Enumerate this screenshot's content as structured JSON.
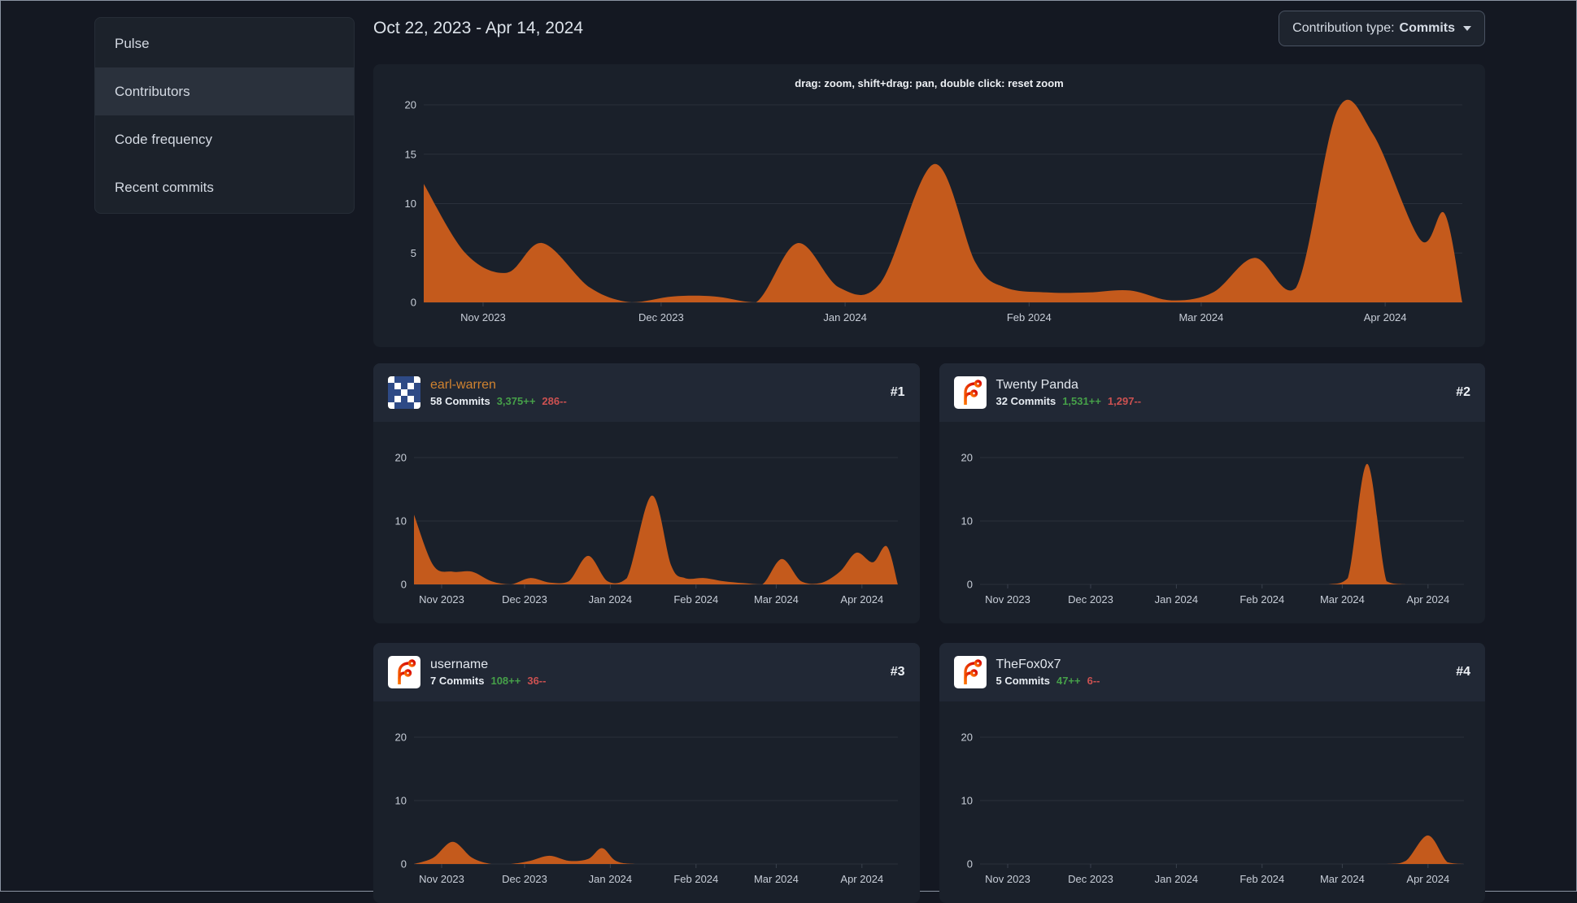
{
  "colors": {
    "bg": "#141822",
    "panel": "#1a202a",
    "card_head": "#212835",
    "side": "#1c222b",
    "side_active": "#2a313c",
    "chart_orange": "#c45a1c",
    "green": "#46a049",
    "red": "#cc5151",
    "link_orange": "#d0822f"
  },
  "sidebar": {
    "items": [
      {
        "label": "Pulse"
      },
      {
        "label": "Contributors"
      },
      {
        "label": "Code frequency"
      },
      {
        "label": "Recent commits"
      }
    ]
  },
  "header": {
    "date_range": "Oct 22, 2023 - Apr 14, 2024",
    "contribution_type_label": "Contribution type:",
    "contribution_type_value": "Commits"
  },
  "main_chart": {
    "hint": "drag: zoom, shift+drag: pan, double click: reset zoom"
  },
  "contributors": [
    {
      "name": "earl-warren",
      "rank": "#1",
      "commits": "58 Commits",
      "additions": "3,375++",
      "deletions": "286--"
    },
    {
      "name": "Twenty Panda",
      "rank": "#2",
      "commits": "32 Commits",
      "additions": "1,531++",
      "deletions": "1,297--"
    },
    {
      "name": "username",
      "rank": "#3",
      "commits": "7 Commits",
      "additions": "108++",
      "deletions": "36--"
    },
    {
      "name": "TheFox0x7",
      "rank": "#4",
      "commits": "5 Commits",
      "additions": "47++",
      "deletions": "6--"
    }
  ],
  "chart_data": [
    {
      "type": "area",
      "name": "All contributors commit activity",
      "x_start": "Oct 22, 2023",
      "x_end": "Apr 14, 2024",
      "x_range_days": 175,
      "ylim": [
        0,
        20
      ],
      "yticks": [
        0,
        5,
        10,
        15,
        20
      ],
      "xticks": [
        {
          "label": "Nov 2023",
          "day": 10
        },
        {
          "label": "Dec 2023",
          "day": 40
        },
        {
          "label": "Jan 2024",
          "day": 71
        },
        {
          "label": "Feb 2024",
          "day": 102
        },
        {
          "label": "Mar 2024",
          "day": 131
        },
        {
          "label": "Apr 2024",
          "day": 162
        }
      ],
      "points": [
        [
          0,
          12
        ],
        [
          7,
          5
        ],
        [
          14,
          3
        ],
        [
          20,
          6
        ],
        [
          28,
          1.5
        ],
        [
          35,
          0
        ],
        [
          42,
          0.6
        ],
        [
          49,
          0.6
        ],
        [
          56,
          0
        ],
        [
          63,
          6
        ],
        [
          70,
          1.5
        ],
        [
          77,
          2
        ],
        [
          86,
          14
        ],
        [
          93,
          4
        ],
        [
          98,
          1.5
        ],
        [
          105,
          1
        ],
        [
          112,
          1
        ],
        [
          119,
          1.2
        ],
        [
          126,
          0.2
        ],
        [
          133,
          1
        ],
        [
          140,
          4.5
        ],
        [
          147,
          1.5
        ],
        [
          154,
          19.5
        ],
        [
          160,
          17
        ],
        [
          168,
          6.3
        ],
        [
          172,
          9
        ],
        [
          175,
          0
        ]
      ],
      "color": "#c45a1c"
    },
    {
      "type": "area",
      "name": "earl-warren commit activity",
      "x_range_days": 175,
      "ylim": [
        0,
        20
      ],
      "yticks": [
        0,
        10,
        20
      ],
      "xticks": [
        {
          "label": "Nov 2023",
          "day": 10
        },
        {
          "label": "Dec 2023",
          "day": 40
        },
        {
          "label": "Jan 2024",
          "day": 71
        },
        {
          "label": "Feb 2024",
          "day": 102
        },
        {
          "label": "Mar 2024",
          "day": 131
        },
        {
          "label": "Apr 2024",
          "day": 162
        }
      ],
      "points": [
        [
          0,
          11
        ],
        [
          7,
          3
        ],
        [
          14,
          2
        ],
        [
          21,
          2
        ],
        [
          28,
          0.5
        ],
        [
          35,
          0
        ],
        [
          42,
          1
        ],
        [
          49,
          0.3
        ],
        [
          56,
          0.5
        ],
        [
          63,
          4.5
        ],
        [
          70,
          0.5
        ],
        [
          77,
          1
        ],
        [
          86,
          14
        ],
        [
          93,
          3
        ],
        [
          98,
          1
        ],
        [
          105,
          1
        ],
        [
          112,
          0.5
        ],
        [
          119,
          0.2
        ],
        [
          126,
          0
        ],
        [
          133,
          4
        ],
        [
          140,
          0.5
        ],
        [
          147,
          0.2
        ],
        [
          154,
          2
        ],
        [
          160,
          5
        ],
        [
          166,
          3.5
        ],
        [
          171,
          6
        ],
        [
          175,
          0
        ]
      ],
      "color": "#c45a1c"
    },
    {
      "type": "area",
      "name": "Twenty Panda commit activity",
      "x_range_days": 175,
      "ylim": [
        0,
        20
      ],
      "yticks": [
        0,
        10,
        20
      ],
      "xticks": [
        {
          "label": "Nov 2023",
          "day": 10
        },
        {
          "label": "Dec 2023",
          "day": 40
        },
        {
          "label": "Jan 2024",
          "day": 71
        },
        {
          "label": "Feb 2024",
          "day": 102
        },
        {
          "label": "Mar 2024",
          "day": 131
        },
        {
          "label": "Apr 2024",
          "day": 162
        }
      ],
      "points": [
        [
          0,
          0
        ],
        [
          28,
          0
        ],
        [
          56,
          0
        ],
        [
          84,
          0
        ],
        [
          112,
          0
        ],
        [
          126,
          0
        ],
        [
          133,
          1
        ],
        [
          140,
          19
        ],
        [
          147,
          0.5
        ],
        [
          154,
          0
        ],
        [
          168,
          0
        ],
        [
          175,
          0
        ]
      ],
      "color": "#c45a1c"
    },
    {
      "type": "area",
      "name": "username commit activity",
      "x_range_days": 175,
      "ylim": [
        0,
        20
      ],
      "yticks": [
        0,
        10,
        20
      ],
      "xticks": [
        {
          "label": "Nov 2023",
          "day": 10
        },
        {
          "label": "Dec 2023",
          "day": 40
        },
        {
          "label": "Jan 2024",
          "day": 71
        },
        {
          "label": "Feb 2024",
          "day": 102
        },
        {
          "label": "Mar 2024",
          "day": 131
        },
        {
          "label": "Apr 2024",
          "day": 162
        }
      ],
      "points": [
        [
          0,
          0
        ],
        [
          7,
          1
        ],
        [
          14,
          3.5
        ],
        [
          21,
          1
        ],
        [
          28,
          0
        ],
        [
          35,
          0
        ],
        [
          42,
          0.5
        ],
        [
          49,
          1.3
        ],
        [
          56,
          0.5
        ],
        [
          63,
          0.8
        ],
        [
          68,
          2.5
        ],
        [
          73,
          0.5
        ],
        [
          80,
          0
        ],
        [
          98,
          0
        ],
        [
          126,
          0
        ],
        [
          154,
          0
        ],
        [
          175,
          0
        ]
      ],
      "color": "#c45a1c"
    },
    {
      "type": "area",
      "name": "TheFox0x7 commit activity",
      "x_range_days": 175,
      "ylim": [
        0,
        20
      ],
      "yticks": [
        0,
        10,
        20
      ],
      "xticks": [
        {
          "label": "Nov 2023",
          "day": 10
        },
        {
          "label": "Dec 2023",
          "day": 40
        },
        {
          "label": "Jan 2024",
          "day": 71
        },
        {
          "label": "Feb 2024",
          "day": 102
        },
        {
          "label": "Mar 2024",
          "day": 131
        },
        {
          "label": "Apr 2024",
          "day": 162
        }
      ],
      "points": [
        [
          0,
          0
        ],
        [
          42,
          0
        ],
        [
          84,
          0
        ],
        [
          126,
          0
        ],
        [
          147,
          0
        ],
        [
          154,
          0.5
        ],
        [
          162,
          4.5
        ],
        [
          169,
          0.3
        ],
        [
          175,
          0
        ]
      ],
      "color": "#c45a1c"
    }
  ]
}
